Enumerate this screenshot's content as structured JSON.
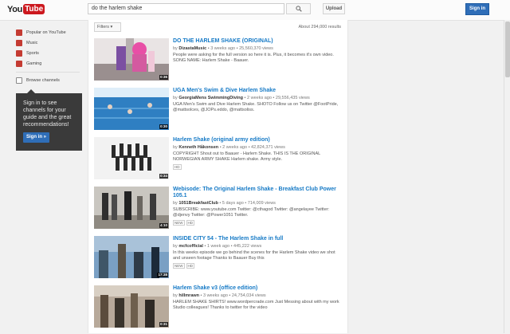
{
  "header": {
    "logo_you": "You",
    "logo_tube": "Tube",
    "search_value": "do the harlem shake",
    "search_icon": "magnifier-icon",
    "upload_label": "Upload",
    "signin_label": "Sign in"
  },
  "guide": {
    "items": [
      {
        "label": "Popular on YouTube",
        "icon": "popular-icon"
      },
      {
        "label": "Music",
        "icon": "music-icon"
      },
      {
        "label": "Sports",
        "icon": "sports-icon"
      },
      {
        "label": "Gaming",
        "icon": "gaming-icon"
      }
    ],
    "browse_label": "Browse channels",
    "promo_text": "Sign in to see channels for your guide and the great recommendations!",
    "promo_button": "Sign in »"
  },
  "filters": {
    "button_label": "Filters ▾",
    "result_count": "About 294,000 results"
  },
  "colors": {
    "accent": "#167ac6",
    "brand": "#cc181e",
    "signin": "#2f6eb8"
  },
  "results": [
    {
      "title": "DO THE HARLEM SHAKE (ORIGINAL)",
      "author": "DizastaMusic",
      "age": "3 weeks ago",
      "views": "25,560,370 views",
      "desc": "People were asking for the full version so here it is. Plus, it becomes it's own video. SONG NAME: Harlem Shake - Baauer.",
      "duration": "0:36",
      "badges": []
    },
    {
      "title": "UGA Men's Swim & Dive Harlem Shake",
      "author": "GeorgiaMens SwimmingDiving",
      "age": "2 weeks ago",
      "views": "29,556,435 views",
      "desc": "UGA Men's Swim and Dive Harlem Shake. SHOTO Follow us on Twitter @FootPride, @mattsolces, @JOPs.eddo, @mattsoliss.",
      "duration": "0:30",
      "badges": []
    },
    {
      "title": "Harlem Shake (original army edition)",
      "author": "Kenneth Håkonsen",
      "age": "2 weeks ago",
      "views": "42,824,371 views",
      "desc": "COPYRIGHT Shout out to Baauer - Harlem Shake. THIS IS THE ORIGINAL NORWEGIAN ARMY SHAKE Harlem shake. Army style.",
      "duration": "0:34",
      "badges": [
        "HD"
      ]
    },
    {
      "title": "Webisode: The Original Harlem Shake - Breakfast Club Power 105.1",
      "author": "1051BreakfastClub",
      "age": "5 days ago",
      "views": "714,009 views",
      "desc": "SUBSCRIBE: www.youtube.com Twitter: @cthagod Twitter: @angelayee Twitter: @djenvy Twitter: @Power1051 Twitter.",
      "duration": "4:10",
      "badges": [
        "NEW",
        "HD"
      ]
    },
    {
      "title": "INSIDE CITY 54 - The Harlem Shake in full",
      "author": "mcfcofficial",
      "age": "1 week ago",
      "views": "445,222 views",
      "desc": "In this weeks episode we go behind the scenes for the Harlem Shake video we shot and unseen footage Thanks to Baauer Buy this",
      "duration": "17:38",
      "badges": [
        "NEW",
        "HD"
      ]
    },
    {
      "title": "Harlem Shake v3 (office edition)",
      "author": "hillmrawn",
      "age": "3 weeks ago",
      "views": "24,754,034 views",
      "desc": "HARLEM SHAKE SHIRTS! www.wordpercrade.com Just Messing about with my work Studio colleagues! Thanks to twitter for the video",
      "duration": "0:31",
      "badges": []
    }
  ]
}
